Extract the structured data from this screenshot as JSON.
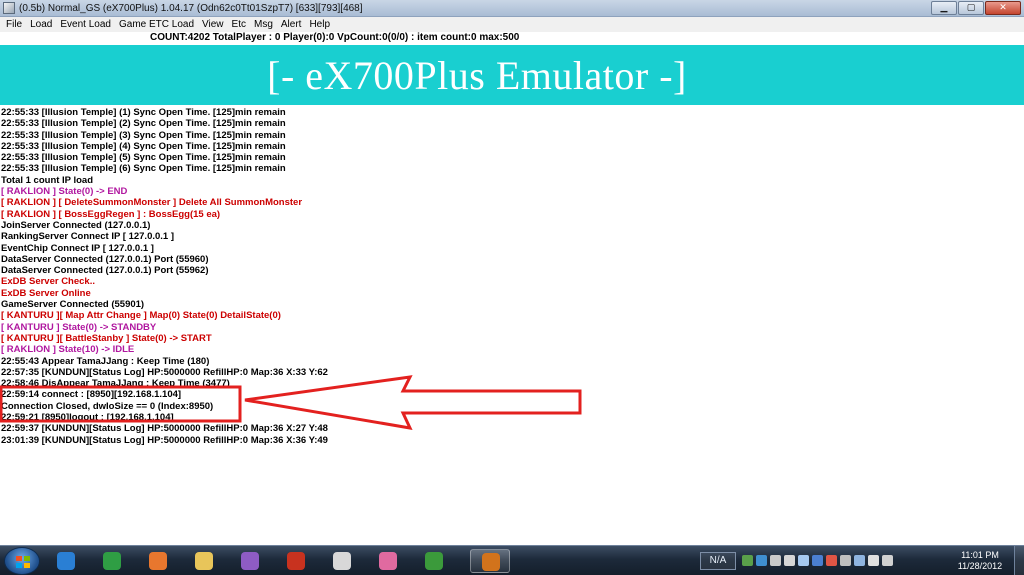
{
  "window": {
    "title": "(0.5b) Normal_GS (eX700Plus) 1.04.17 (Odn62c0Tt01SzpT7) [633][793][468]",
    "controls": {
      "minimize": "▁",
      "maximize": "▢",
      "close": "✕"
    }
  },
  "menu": [
    "File",
    "Load",
    "Event Load",
    "Game ETC Load",
    "View",
    "Etc",
    "Msg",
    "Alert",
    "Help"
  ],
  "status": {
    "text": "COUNT:4202  TotalPlayer : 0  Player(0):0 VpCount:0(0/0) : item count:0 max:500"
  },
  "banner": {
    "text": "[-  eX700Plus Emulator  -]",
    "background": "#19cfd0"
  },
  "colors": {
    "black": "#000000",
    "purple": "#b0179f",
    "red": "#cc0000",
    "annotation_red": "#e3211f"
  },
  "log": [
    {
      "text": "22:55:33 [Illusion Temple] (1) Sync Open Time. [125]min remain",
      "color": "#000000"
    },
    {
      "text": "22:55:33 [Illusion Temple] (2) Sync Open Time. [125]min remain",
      "color": "#000000"
    },
    {
      "text": "22:55:33 [Illusion Temple] (3) Sync Open Time. [125]min remain",
      "color": "#000000"
    },
    {
      "text": "22:55:33 [Illusion Temple] (4) Sync Open Time. [125]min remain",
      "color": "#000000"
    },
    {
      "text": "22:55:33 [Illusion Temple] (5) Sync Open Time. [125]min remain",
      "color": "#000000"
    },
    {
      "text": "22:55:33 [Illusion Temple] (6) Sync Open Time. [125]min remain",
      "color": "#000000"
    },
    {
      "text": "Total 1 count IP load",
      "color": "#000000"
    },
    {
      "text": "[ RAKLION ] State(0) -> END",
      "color": "#b0179f"
    },
    {
      "text": "[ RAKLION ] [ DeleteSummonMonster ] Delete All SummonMonster",
      "color": "#cc0000"
    },
    {
      "text": "[ RAKLION ] [ BossEggRegen ] : BossEgg(15 ea)",
      "color": "#cc0000"
    },
    {
      "text": "JoinServer Connected (127.0.0.1)",
      "color": "#000000"
    },
    {
      "text": "RankingServer Connect IP [ 127.0.0.1 ]",
      "color": "#000000"
    },
    {
      "text": "EventChip Connect IP [ 127.0.0.1 ]",
      "color": "#000000"
    },
    {
      "text": "DataServer Connected (127.0.0.1) Port (55960)",
      "color": "#000000"
    },
    {
      "text": "DataServer Connected (127.0.0.1) Port (55962)",
      "color": "#000000"
    },
    {
      "text": "ExDB Server Check..",
      "color": "#cc0000"
    },
    {
      "text": "ExDB Server Online",
      "color": "#cc0000"
    },
    {
      "text": "GameServer Connected (55901)",
      "color": "#000000"
    },
    {
      "text": "[ KANTURU ][ Map Attr Change ] Map(0) State(0) DetailState(0)",
      "color": "#cc0000"
    },
    {
      "text": "[ KANTURU ] State(0) -> STANDBY",
      "color": "#b0179f"
    },
    {
      "text": "[ KANTURU ][ BattleStanby ] State(0) -> START",
      "color": "#cc0000"
    },
    {
      "text": "[ RAKLION ] State(10) -> IDLE",
      "color": "#b0179f"
    },
    {
      "text": "22:55:43 Appear TamaJJang : Keep Time (180)",
      "color": "#000000"
    },
    {
      "text": "22:57:35 [KUNDUN][Status Log] HP:5000000 RefillHP:0 Map:36 X:33 Y:62",
      "color": "#000000"
    },
    {
      "text": "22:58:46 DisAppear TamaJJang : Keep Time (3477)",
      "color": "#000000"
    },
    {
      "text": "22:59:14 connect : [8950][192.168.1.104]",
      "color": "#000000"
    },
    {
      "text": "Connection Closed, dwIoSize == 0 (Index:8950)",
      "color": "#000000"
    },
    {
      "text": "22:59:21 [8950]logout :  [192.168.1.104]",
      "color": "#000000"
    },
    {
      "text": "22:59:37 [KUNDUN][Status Log] HP:5000000 RefillHP:0 Map:36 X:27 Y:48",
      "color": "#000000"
    },
    {
      "text": "23:01:39 [KUNDUN][Status Log] HP:5000000 RefillHP:0 Map:36 X:36 Y:49",
      "color": "#000000"
    }
  ],
  "taskbar": {
    "apps": [
      {
        "name": "internet-explorer-icon",
        "color": "#2a7fd4"
      },
      {
        "name": "chrome-icon",
        "color": "#2f9e44"
      },
      {
        "name": "firefox-icon",
        "color": "#e8772e"
      },
      {
        "name": "file-explorer-icon",
        "color": "#e8c55a"
      },
      {
        "name": "visual-studio-icon",
        "color": "#8e5cc4"
      },
      {
        "name": "flash-icon",
        "color": "#c8321f"
      },
      {
        "name": "app-icon-grid",
        "color": "#d8d8d8"
      },
      {
        "name": "paint-icon",
        "color": "#e06aa0"
      },
      {
        "name": "network-globe-icon",
        "color": "#3b9a3b"
      },
      {
        "name": "game-server-icon",
        "color": "#d2731c"
      }
    ],
    "tray_label": "N/A",
    "clock_time": "11:01 PM",
    "clock_date": "11/28/2012"
  }
}
